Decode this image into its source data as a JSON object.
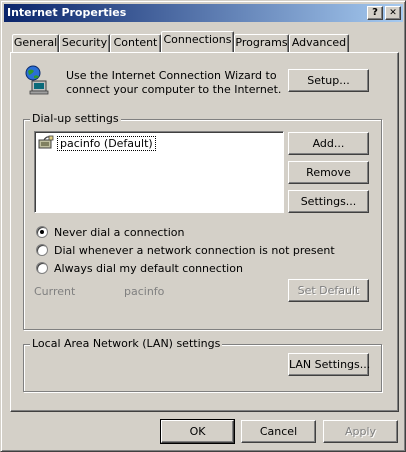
{
  "window": {
    "title": "Internet Properties",
    "help_glyph": "?",
    "close_glyph": "✕"
  },
  "tabs": [
    {
      "label": "General"
    },
    {
      "label": "Security"
    },
    {
      "label": "Content"
    },
    {
      "label": "Connections"
    },
    {
      "label": "Programs"
    },
    {
      "label": "Advanced"
    }
  ],
  "active_tab": "Connections",
  "wizard": {
    "text_line1": "Use the Internet Connection Wizard to",
    "text_line2": "connect your computer to the Internet.",
    "setup_button": "Setup..."
  },
  "dialup": {
    "group_label": "Dial-up settings",
    "connections": [
      {
        "name": "pacinfo (Default)"
      }
    ],
    "add_button": "Add...",
    "remove_button": "Remove",
    "settings_button": "Settings...",
    "options": [
      {
        "label": "Never dial a connection",
        "checked": true
      },
      {
        "label": "Dial whenever a network connection is not present",
        "checked": false
      },
      {
        "label": "Always dial my default connection",
        "checked": false
      }
    ],
    "current_label": "Current",
    "current_value": "pacinfo",
    "set_default_button": "Set Default"
  },
  "lan": {
    "group_label": "Local Area Network (LAN) settings",
    "button": "LAN Settings..."
  },
  "footer": {
    "ok": "OK",
    "cancel": "Cancel",
    "apply": "Apply"
  },
  "colors": {
    "titlebar_start": "#0a246a",
    "titlebar_end": "#a6caf0",
    "face": "#d4d0c8"
  }
}
